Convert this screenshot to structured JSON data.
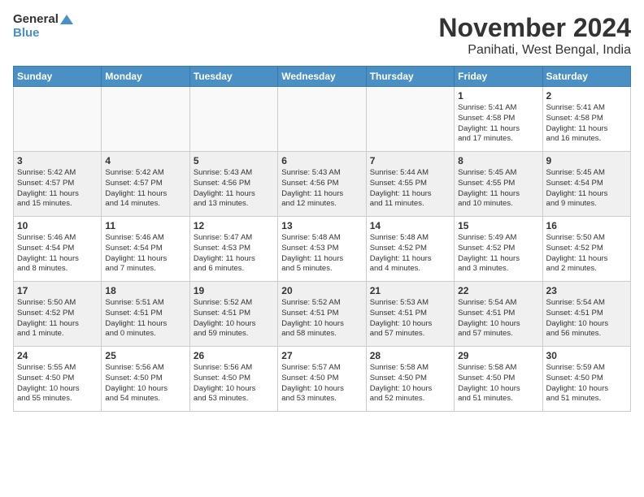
{
  "header": {
    "logo_line1": "General",
    "logo_line2": "Blue",
    "month": "November 2024",
    "location": "Panihati, West Bengal, India"
  },
  "weekdays": [
    "Sunday",
    "Monday",
    "Tuesday",
    "Wednesday",
    "Thursday",
    "Friday",
    "Saturday"
  ],
  "weeks": [
    [
      {
        "day": "",
        "info": ""
      },
      {
        "day": "",
        "info": ""
      },
      {
        "day": "",
        "info": ""
      },
      {
        "day": "",
        "info": ""
      },
      {
        "day": "",
        "info": ""
      },
      {
        "day": "1",
        "info": "Sunrise: 5:41 AM\nSunset: 4:58 PM\nDaylight: 11 hours\nand 17 minutes."
      },
      {
        "day": "2",
        "info": "Sunrise: 5:41 AM\nSunset: 4:58 PM\nDaylight: 11 hours\nand 16 minutes."
      }
    ],
    [
      {
        "day": "3",
        "info": "Sunrise: 5:42 AM\nSunset: 4:57 PM\nDaylight: 11 hours\nand 15 minutes."
      },
      {
        "day": "4",
        "info": "Sunrise: 5:42 AM\nSunset: 4:57 PM\nDaylight: 11 hours\nand 14 minutes."
      },
      {
        "day": "5",
        "info": "Sunrise: 5:43 AM\nSunset: 4:56 PM\nDaylight: 11 hours\nand 13 minutes."
      },
      {
        "day": "6",
        "info": "Sunrise: 5:43 AM\nSunset: 4:56 PM\nDaylight: 11 hours\nand 12 minutes."
      },
      {
        "day": "7",
        "info": "Sunrise: 5:44 AM\nSunset: 4:55 PM\nDaylight: 11 hours\nand 11 minutes."
      },
      {
        "day": "8",
        "info": "Sunrise: 5:45 AM\nSunset: 4:55 PM\nDaylight: 11 hours\nand 10 minutes."
      },
      {
        "day": "9",
        "info": "Sunrise: 5:45 AM\nSunset: 4:54 PM\nDaylight: 11 hours\nand 9 minutes."
      }
    ],
    [
      {
        "day": "10",
        "info": "Sunrise: 5:46 AM\nSunset: 4:54 PM\nDaylight: 11 hours\nand 8 minutes."
      },
      {
        "day": "11",
        "info": "Sunrise: 5:46 AM\nSunset: 4:54 PM\nDaylight: 11 hours\nand 7 minutes."
      },
      {
        "day": "12",
        "info": "Sunrise: 5:47 AM\nSunset: 4:53 PM\nDaylight: 11 hours\nand 6 minutes."
      },
      {
        "day": "13",
        "info": "Sunrise: 5:48 AM\nSunset: 4:53 PM\nDaylight: 11 hours\nand 5 minutes."
      },
      {
        "day": "14",
        "info": "Sunrise: 5:48 AM\nSunset: 4:52 PM\nDaylight: 11 hours\nand 4 minutes."
      },
      {
        "day": "15",
        "info": "Sunrise: 5:49 AM\nSunset: 4:52 PM\nDaylight: 11 hours\nand 3 minutes."
      },
      {
        "day": "16",
        "info": "Sunrise: 5:50 AM\nSunset: 4:52 PM\nDaylight: 11 hours\nand 2 minutes."
      }
    ],
    [
      {
        "day": "17",
        "info": "Sunrise: 5:50 AM\nSunset: 4:52 PM\nDaylight: 11 hours\nand 1 minute."
      },
      {
        "day": "18",
        "info": "Sunrise: 5:51 AM\nSunset: 4:51 PM\nDaylight: 11 hours\nand 0 minutes."
      },
      {
        "day": "19",
        "info": "Sunrise: 5:52 AM\nSunset: 4:51 PM\nDaylight: 10 hours\nand 59 minutes."
      },
      {
        "day": "20",
        "info": "Sunrise: 5:52 AM\nSunset: 4:51 PM\nDaylight: 10 hours\nand 58 minutes."
      },
      {
        "day": "21",
        "info": "Sunrise: 5:53 AM\nSunset: 4:51 PM\nDaylight: 10 hours\nand 57 minutes."
      },
      {
        "day": "22",
        "info": "Sunrise: 5:54 AM\nSunset: 4:51 PM\nDaylight: 10 hours\nand 57 minutes."
      },
      {
        "day": "23",
        "info": "Sunrise: 5:54 AM\nSunset: 4:51 PM\nDaylight: 10 hours\nand 56 minutes."
      }
    ],
    [
      {
        "day": "24",
        "info": "Sunrise: 5:55 AM\nSunset: 4:50 PM\nDaylight: 10 hours\nand 55 minutes."
      },
      {
        "day": "25",
        "info": "Sunrise: 5:56 AM\nSunset: 4:50 PM\nDaylight: 10 hours\nand 54 minutes."
      },
      {
        "day": "26",
        "info": "Sunrise: 5:56 AM\nSunset: 4:50 PM\nDaylight: 10 hours\nand 53 minutes."
      },
      {
        "day": "27",
        "info": "Sunrise: 5:57 AM\nSunset: 4:50 PM\nDaylight: 10 hours\nand 53 minutes."
      },
      {
        "day": "28",
        "info": "Sunrise: 5:58 AM\nSunset: 4:50 PM\nDaylight: 10 hours\nand 52 minutes."
      },
      {
        "day": "29",
        "info": "Sunrise: 5:58 AM\nSunset: 4:50 PM\nDaylight: 10 hours\nand 51 minutes."
      },
      {
        "day": "30",
        "info": "Sunrise: 5:59 AM\nSunset: 4:50 PM\nDaylight: 10 hours\nand 51 minutes."
      }
    ]
  ]
}
